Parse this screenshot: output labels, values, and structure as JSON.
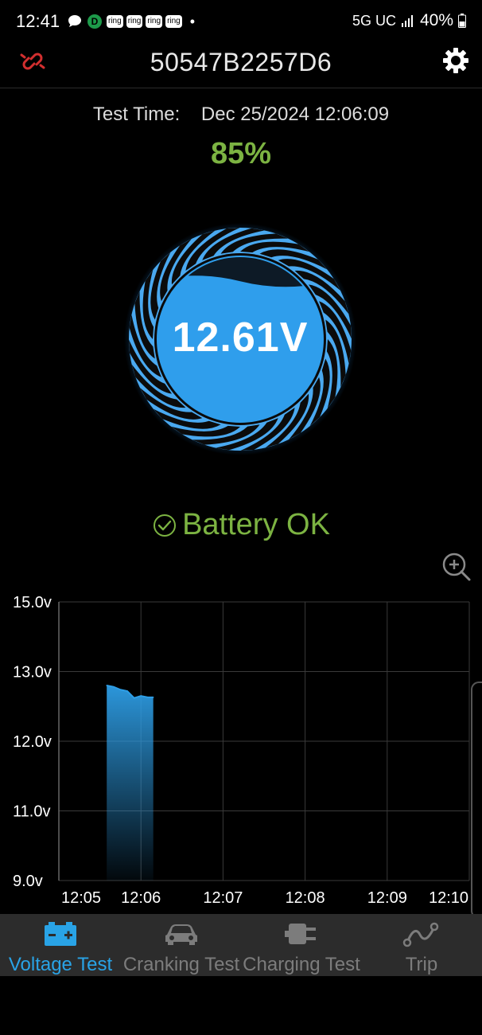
{
  "status_bar": {
    "time": "12:41",
    "ring_badges": [
      "ring",
      "ring",
      "ring",
      "ring"
    ],
    "d_badge": "D",
    "dot": "•",
    "network": "5G UC",
    "battery": "40%"
  },
  "header": {
    "title": "50547B2257D6",
    "left_icon": "disconnected-link-icon",
    "right_icon": "gear-icon"
  },
  "test_time": {
    "label": "Test Time:",
    "value": "Dec 25/2024 12:06:09"
  },
  "battery_percent": "85%",
  "gauge": {
    "voltage": "12.61V",
    "fill_fraction": 0.85,
    "accent": "#2e9ee6"
  },
  "status_message": "Battery OK",
  "status_color": "#7cb342",
  "chart_data": {
    "type": "area",
    "x_labels": [
      "12:05",
      "12:06",
      "12:07",
      "12:08",
      "12:09",
      "12:10"
    ],
    "y_labels": [
      "15.0v",
      "13.0v",
      "12.0v",
      "11.0v",
      "9.0v"
    ],
    "grid": true,
    "series": [
      {
        "x": [
          "12:05:35",
          "12:05:40",
          "12:05:45",
          "12:05:50",
          "12:05:55",
          "12:06:00",
          "12:06:05",
          "12:06:09"
        ],
        "values": [
          12.8,
          12.78,
          12.74,
          12.72,
          12.62,
          12.65,
          12.63,
          12.63
        ],
        "color": "#2e9ee6"
      }
    ]
  },
  "nav": {
    "items": [
      {
        "label": "Voltage Test",
        "icon": "battery-icon",
        "active": true
      },
      {
        "label": "Cranking Test",
        "icon": "car-icon",
        "active": false
      },
      {
        "label": "Charging Test",
        "icon": "plug-icon",
        "active": false
      },
      {
        "label": "Trip",
        "icon": "route-icon",
        "active": false
      }
    ]
  }
}
